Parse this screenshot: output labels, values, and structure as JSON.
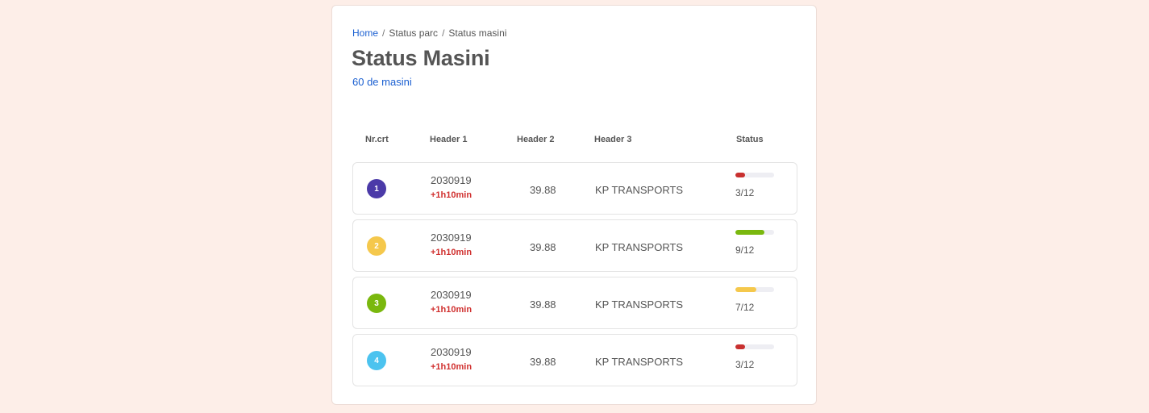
{
  "breadcrumb": {
    "home": "Home",
    "separator": "/",
    "level2": "Status parc",
    "current": "Status masini"
  },
  "page": {
    "title": "Status Masini",
    "subtitle": "60 de masini"
  },
  "table": {
    "headers": {
      "nr": "Nr.crt",
      "h1": "Header 1",
      "h2": "Header 2",
      "h3": "Header 3",
      "status": "Status"
    },
    "rows": [
      {
        "nr": "1",
        "badge_color": "#4b3aa8",
        "h1": "2030919",
        "h1_sub": "+1h10min",
        "h2": "39.88",
        "h3": "KP TRANSPORTS",
        "status": "3/12",
        "progress": 0.25,
        "progress_color": "#c8302f"
      },
      {
        "nr": "2",
        "badge_color": "#f5c84c",
        "h1": "2030919",
        "h1_sub": "+1h10min",
        "h2": "39.88",
        "h3": "KP TRANSPORTS",
        "status": "9/12",
        "progress": 0.75,
        "progress_color": "#7ab80e"
      },
      {
        "nr": "3",
        "badge_color": "#7ab80e",
        "h1": "2030919",
        "h1_sub": "+1h10min",
        "h2": "39.88",
        "h3": "KP TRANSPORTS",
        "status": "7/12",
        "progress": 0.55,
        "progress_color": "#f5c84c"
      },
      {
        "nr": "4",
        "badge_color": "#4cc3ef",
        "h1": "2030919",
        "h1_sub": "+1h10min",
        "h2": "39.88",
        "h3": "KP TRANSPORTS",
        "status": "3/12",
        "progress": 0.25,
        "progress_color": "#c8302f"
      }
    ]
  }
}
